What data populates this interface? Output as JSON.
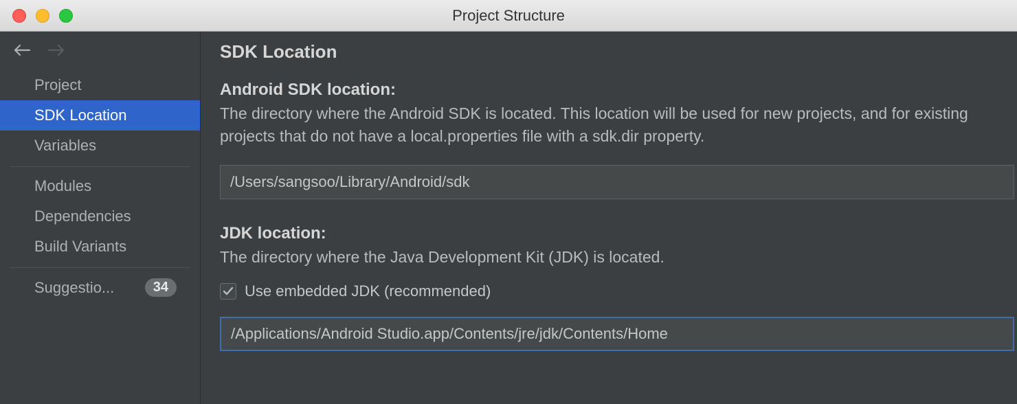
{
  "window": {
    "title": "Project Structure"
  },
  "sidebar": {
    "items": [
      {
        "label": "Project"
      },
      {
        "label": "SDK Location"
      },
      {
        "label": "Variables"
      },
      {
        "label": "Modules"
      },
      {
        "label": "Dependencies"
      },
      {
        "label": "Build Variants"
      },
      {
        "label": "Suggestio...",
        "badge": "34"
      }
    ]
  },
  "content": {
    "heading": "SDK Location",
    "android_sdk": {
      "title": "Android SDK location:",
      "desc": "The directory where the Android SDK is located. This location will be used for new projects, and for existing projects that do not have a local.properties file with a sdk.dir property.",
      "value": "/Users/sangsoo/Library/Android/sdk"
    },
    "jdk": {
      "title": "JDK location:",
      "desc": "The directory where the Java Development Kit (JDK) is located.",
      "checkbox_label": "Use embedded JDK (recommended)",
      "checked": true,
      "value": "/Applications/Android Studio.app/Contents/jre/jdk/Contents/Home"
    }
  }
}
